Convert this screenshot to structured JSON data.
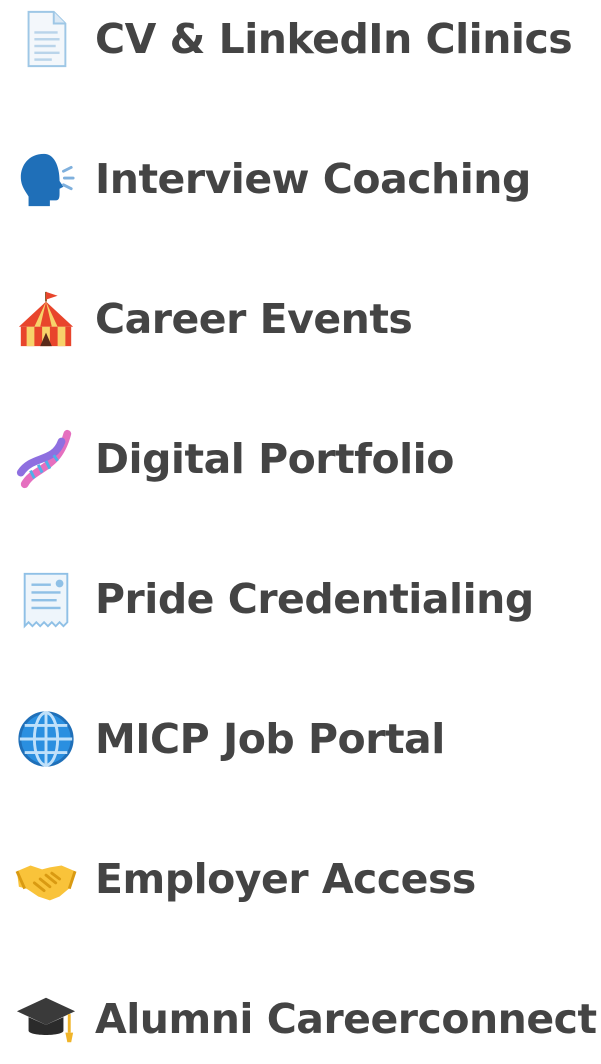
{
  "menu": {
    "items": [
      {
        "label": "CV & LinkedIn Clinics",
        "icon": "page-facing-up-icon"
      },
      {
        "label": "Interview Coaching",
        "icon": "speaking-head-icon"
      },
      {
        "label": "Career Events",
        "icon": "circus-tent-icon"
      },
      {
        "label": "Digital Portfolio",
        "icon": "dna-icon"
      },
      {
        "label": "Pride Credentialing",
        "icon": "receipt-icon"
      },
      {
        "label": "MICP Job Portal",
        "icon": "globe-meridians-icon"
      },
      {
        "label": "Employer Access",
        "icon": "handshake-icon"
      },
      {
        "label": "Alumni Careerconnect",
        "icon": "graduation-cap-icon"
      }
    ]
  },
  "colors": {
    "text": "#444444",
    "background": "#ffffff"
  }
}
